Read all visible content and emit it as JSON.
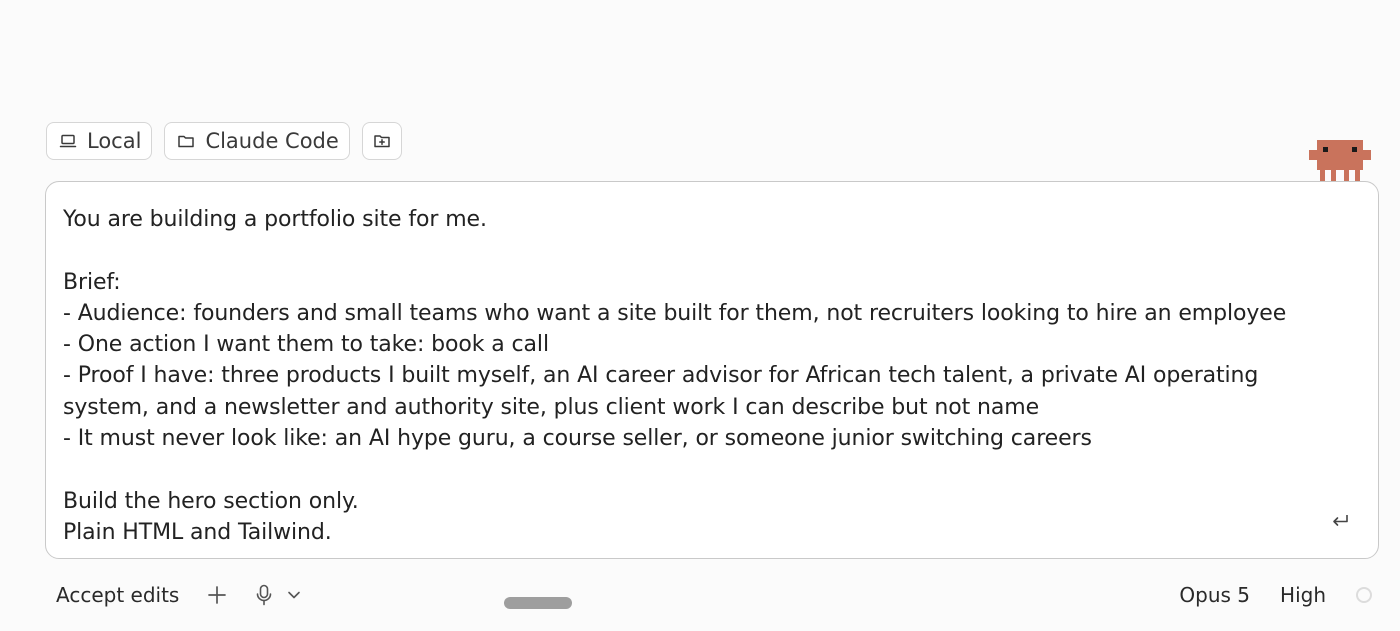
{
  "chips": {
    "environment_label": "Local",
    "folder_label": "Claude Code"
  },
  "composer": {
    "text": "You are building a portfolio site for me.\n\nBrief:\n- Audience: founders and small teams who want a site built for them, not recruiters looking to hire an employee\n- One action I want them to take: book a call\n- Proof I have: three products I built myself, an AI career advisor for African tech talent, a private AI operating system, and a newsletter and authority site, plus client work I can describe but not name\n- It must never look like: an AI hype guru, a course seller, or someone junior switching careers\n\nBuild the hero section only.\nPlain HTML and Tailwind."
  },
  "toolbar": {
    "accept_edits_label": "Accept edits",
    "model_label": "Opus 5",
    "effort_label": "High"
  },
  "colors": {
    "mascot": "#c9735c",
    "border": "#c9c9c9",
    "background": "#fbfbfb"
  },
  "icons": {
    "environment": "laptop-icon",
    "folder": "folder-icon",
    "add_folder": "folder-plus-icon",
    "submit": "enter-icon",
    "add": "plus-icon",
    "voice": "microphone-icon",
    "voice_options": "chevron-down-icon",
    "mascot": "claude-mascot-icon"
  }
}
